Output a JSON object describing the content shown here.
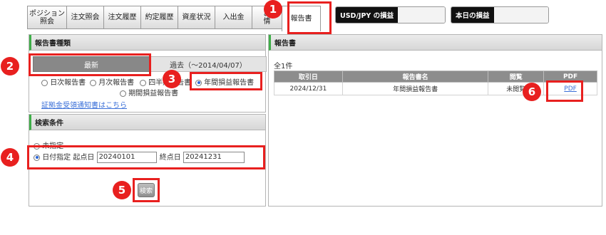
{
  "nav": {
    "tabs": [
      {
        "label": "ポジション\n照会"
      },
      {
        "label": "注文照会"
      },
      {
        "label": "注文履歴"
      },
      {
        "label": "約定履歴"
      },
      {
        "label": "資産状況"
      },
      {
        "label": "入出金"
      },
      {
        "label": "お\n情"
      },
      {
        "label": "報告書"
      }
    ]
  },
  "pl_usdjpy": {
    "label": "USD/JPY の損益",
    "value": ""
  },
  "pl_today": {
    "label": "本日の損益",
    "value": ""
  },
  "report_type": {
    "title": "報告書種類",
    "latest_label": "最新",
    "past_label": "過去（～2014/04/07）",
    "options": [
      "日次報告書",
      "月次報告書",
      "四半期報告書",
      "年間損益報告書",
      "期間損益報告書"
    ],
    "selected": "年間損益報告書",
    "link": "証拠金受領通知書はこちら"
  },
  "search": {
    "title": "検索条件",
    "unspecified_label": "未指定",
    "date_label": "日付指定 起点日",
    "start_date": "20240101",
    "end_label": "終点日",
    "end_date": "20241231",
    "button_label": "検索"
  },
  "reports": {
    "title": "報告書",
    "count_label": "全1件",
    "columns": [
      "取引日",
      "報告書名",
      "閲覧",
      "PDF"
    ],
    "rows": [
      {
        "date": "2024/12/31",
        "name": "年間損益報告書",
        "status": "未閲覧",
        "pdf": "PDF"
      }
    ]
  },
  "callouts": [
    "1",
    "2",
    "3",
    "4",
    "5",
    "6"
  ],
  "colors": {
    "highlight": "#e8201f",
    "accent": "#3fae49",
    "header_gray": "#8d8d8d"
  }
}
